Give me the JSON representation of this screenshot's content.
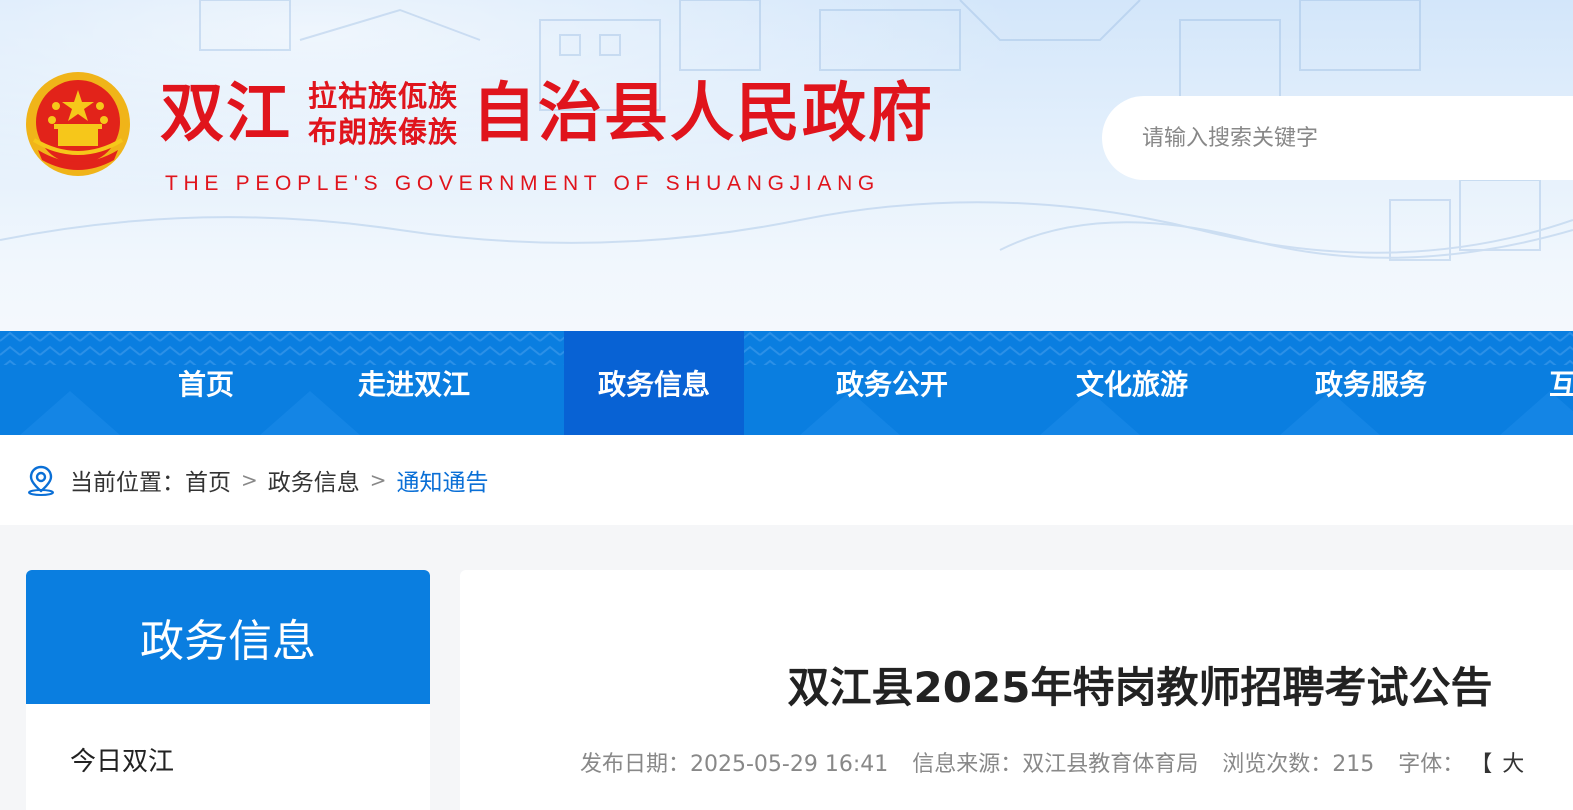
{
  "header": {
    "title_part1": "双江",
    "title_stack_line1": "拉祜族佤族",
    "title_stack_line2": "布朗族傣族",
    "title_part2": "自治县人民政府",
    "title_en": "THE PEOPLE'S GOVERNMENT OF SHUANGJIANG",
    "search_placeholder": "请输入搜索关键字",
    "brand_color": "#e0141c"
  },
  "nav": {
    "items": [
      {
        "label": "首页"
      },
      {
        "label": "走进双江"
      },
      {
        "label": "政务信息",
        "active": true
      },
      {
        "label": "政务公开"
      },
      {
        "label": "文化旅游"
      },
      {
        "label": "政务服务"
      },
      {
        "label": "互"
      }
    ],
    "bg_color": "#0a7ee0",
    "active_color": "#0862d4"
  },
  "breadcrumb": {
    "prefix": "当前位置：",
    "items": [
      "首页",
      "政务信息",
      "通知通告"
    ],
    "separator": ">"
  },
  "sidebar": {
    "title": "政务信息",
    "items": [
      "今日双江"
    ]
  },
  "article": {
    "title": "双江县2025年特岗教师招聘考试公告",
    "publish_date": "发布日期：2025-05-29 16:41",
    "source": "信息来源：双江县教育体育局",
    "views": "浏览次数：215",
    "font_label": "字体：",
    "font_open": "【",
    "font_large": "大"
  }
}
